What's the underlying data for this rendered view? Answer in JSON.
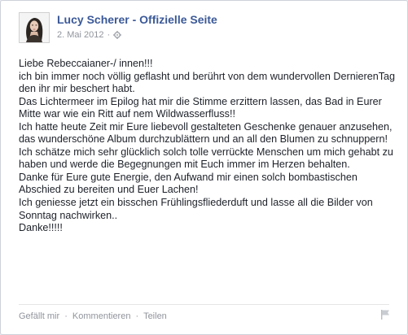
{
  "header": {
    "page_name": "Lucy Scherer - Offizielle Seite",
    "date": "2. Mai 2012",
    "separator": "·",
    "audience_icon": "gear-icon",
    "avatar_icon": "profile-photo"
  },
  "post": {
    "text": "Liebe Rebeccaianer-/ innen!!!\nich bin immer noch völlig geflasht und berührt von dem wundervollen DernierenTag den ihr mir beschert habt.\nDas Lichtermeer im Epilog hat mir die Stimme erzittern lassen, das Bad in Eurer Mitte war wie ein Ritt auf nem Wildwasserfluss!!\nIch hatte heute Zeit mir Eure liebevoll gestalteten Geschenke genauer anzusehen, das wunderschöne Album durchzublättern und an all den Blumen zu schnuppern!\nIch schätze mich sehr glücklich solch tolle verrückte Menschen um mich gehabt zu haben und werde die Begegnungen mit Euch immer im Herzen behalten.\nDanke für Eure gute Energie, den Aufwand mir einen solch bombastischen Abschied zu bereiten und Euer Lachen!\nIch geniesse jetzt ein bisschen Frühlingsfliederduft und lasse all die Bilder von Sonntag nachwirken..\nDanke!!!!!"
  },
  "actions": {
    "like": "Gefällt mir",
    "comment": "Kommentieren",
    "share": "Teilen",
    "dot": "·"
  },
  "colors": {
    "link_blue": "#3b5998",
    "meta_gray": "#90949c",
    "text": "#1d2129"
  }
}
